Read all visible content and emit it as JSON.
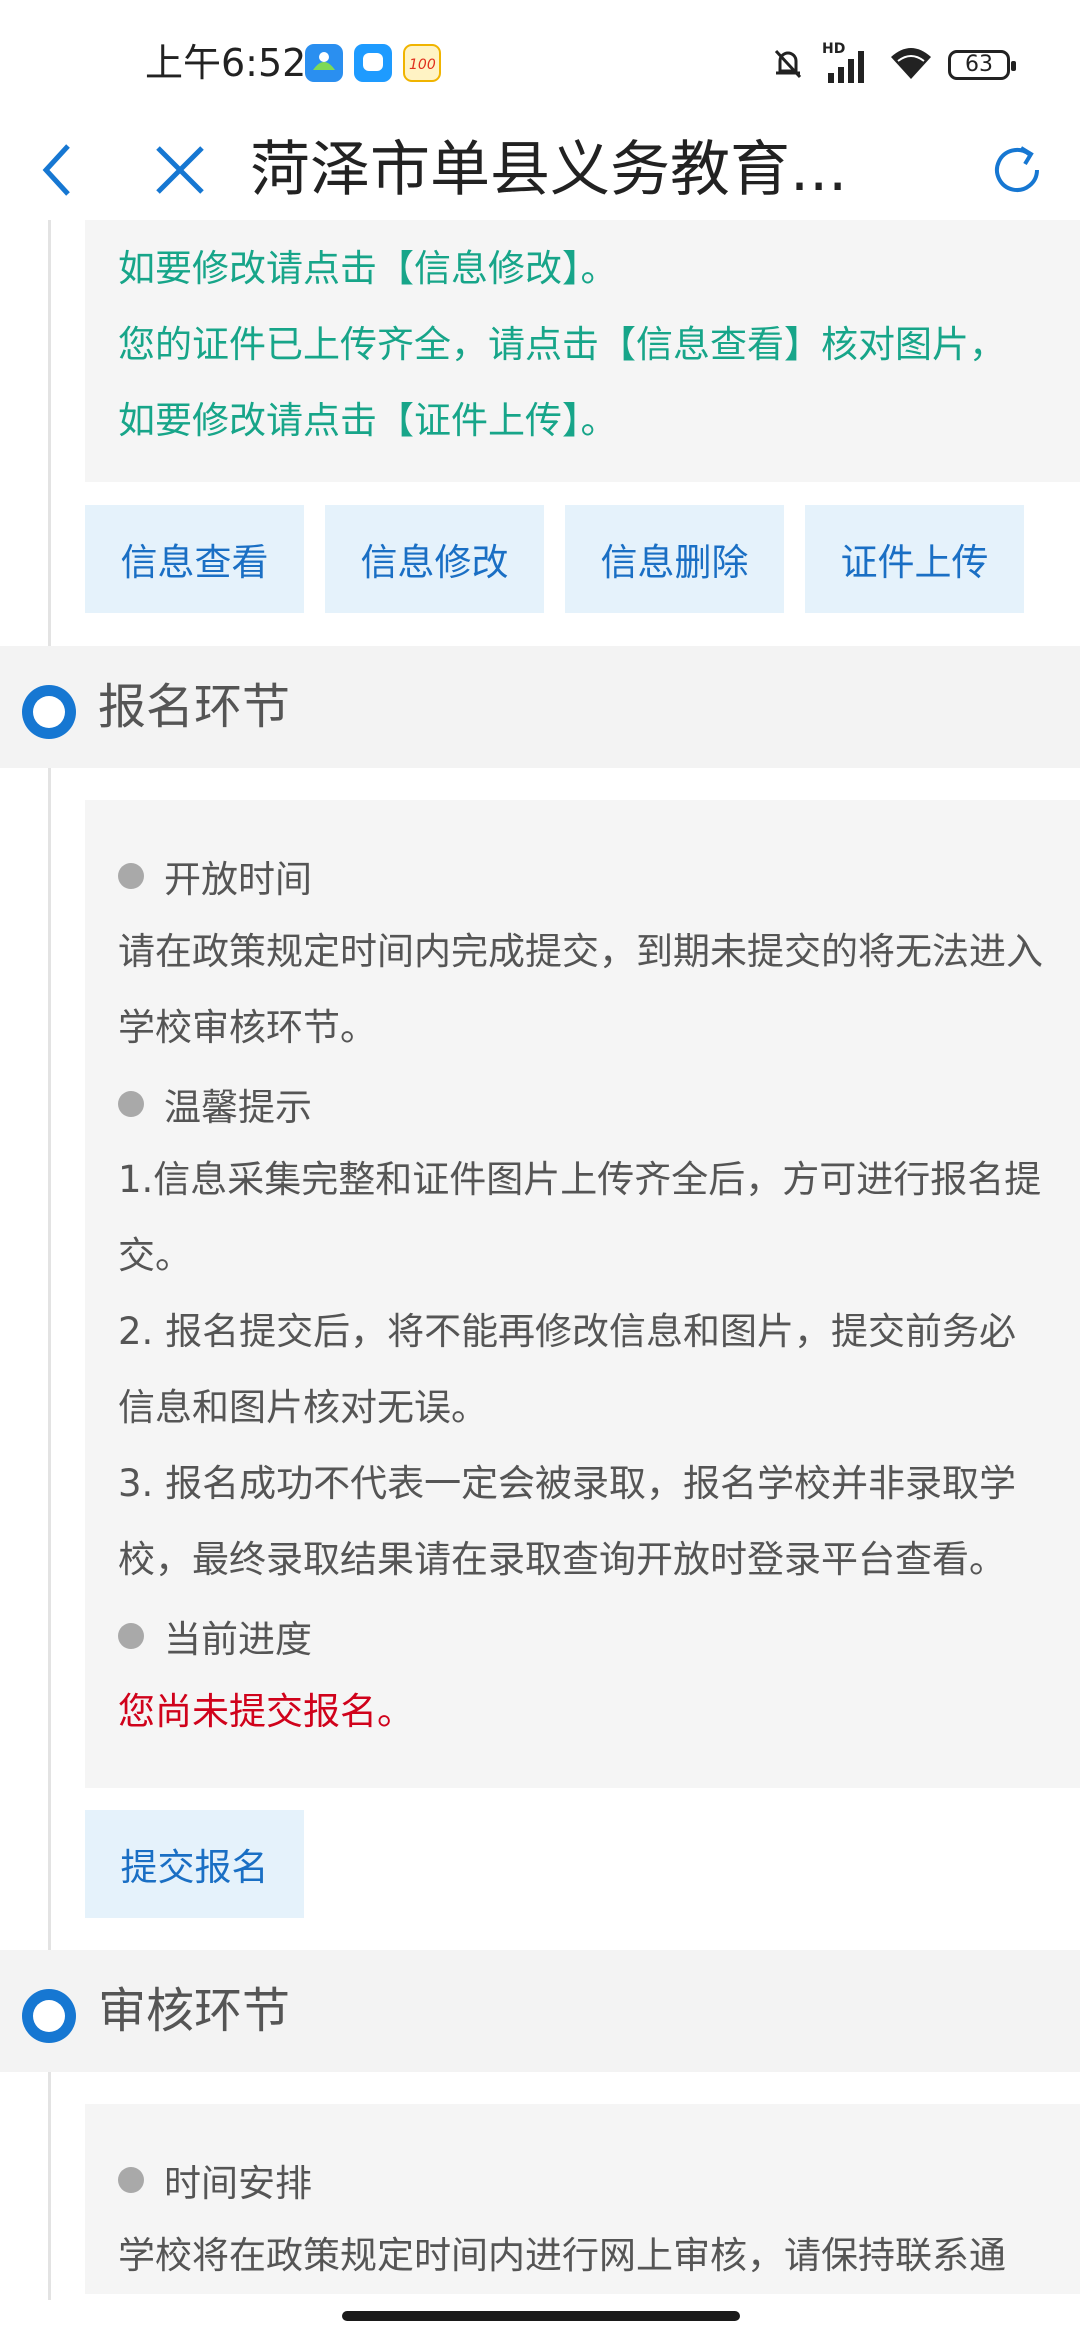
{
  "status_bar": {
    "time": "上午6:52",
    "hd_label": "HD",
    "battery": "63"
  },
  "nav": {
    "title": "菏泽市单县义务教育..."
  },
  "top_box": {
    "lines": [
      "如要修改请点击【信息修改】。",
      "您的证件已上传齐全，请点击【信息查看】核对图片，",
      "如要修改请点击【证件上传】。"
    ]
  },
  "buttons": {
    "view": "信息查看",
    "edit": "信息修改",
    "delete": "信息删除",
    "upload": "证件上传"
  },
  "registration": {
    "title": "报名环节",
    "open_time_label": "开放时间",
    "open_time_text": "请在政策规定时间内完成提交，到期未提交的将无法进入学校审核环节。",
    "tips_label": "温馨提示",
    "tip1": "1.信息采集完整和证件图片上传齐全后，方可进行报名提交。",
    "tip2": "2. 报名提交后，将不能再修改信息和图片，提交前务必信息和图片核对无误。",
    "tip3": "3. 报名成功不代表一定会被录取，报名学校并非录取学校，最终录取结果请在录取查询开放时登录平台查看。",
    "progress_label": "当前进度",
    "progress_text": "您尚未提交报名。",
    "submit_button": "提交报名"
  },
  "review": {
    "title": "审核环节",
    "schedule_label": "时间安排",
    "schedule_text": "学校将在政策规定时间内进行网上审核，请保持联系通"
  },
  "colors": {
    "accent_blue": "#1677d2",
    "link_green": "#17a589",
    "warning_red": "#d0021b",
    "button_bg": "#e5f2fb"
  }
}
